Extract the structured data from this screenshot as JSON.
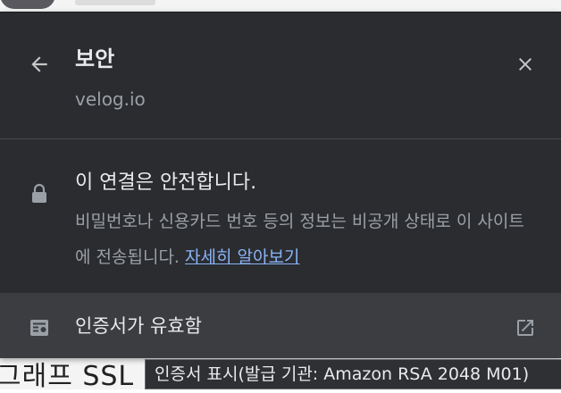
{
  "popup": {
    "title": "보안",
    "domain": "velog.io",
    "connection": {
      "title": "이 연결은 안전합니다.",
      "description": "비밀번호나 신용카드 번호 등의 정보는 비공개 상태로 이 사이트에 전송됩니다.",
      "learn_more": "자세히 알아보기"
    },
    "certificate": {
      "label": "인증서가 유효함"
    }
  },
  "tooltip": {
    "text": "인증서 표시(발급 기관: Amazon RSA 2048 M01)"
  },
  "background": {
    "partial_text": "그래프 SSL"
  },
  "icons": {
    "back": "arrow-left-icon",
    "close": "close-icon",
    "lock": "lock-icon",
    "certificate": "certificate-icon",
    "external": "open-external-icon"
  },
  "colors": {
    "panel_bg": "#2b2c30",
    "row_hover_bg": "#3c3d41",
    "link": "#8ab4f8",
    "secondary_text": "#9aa0a6"
  }
}
